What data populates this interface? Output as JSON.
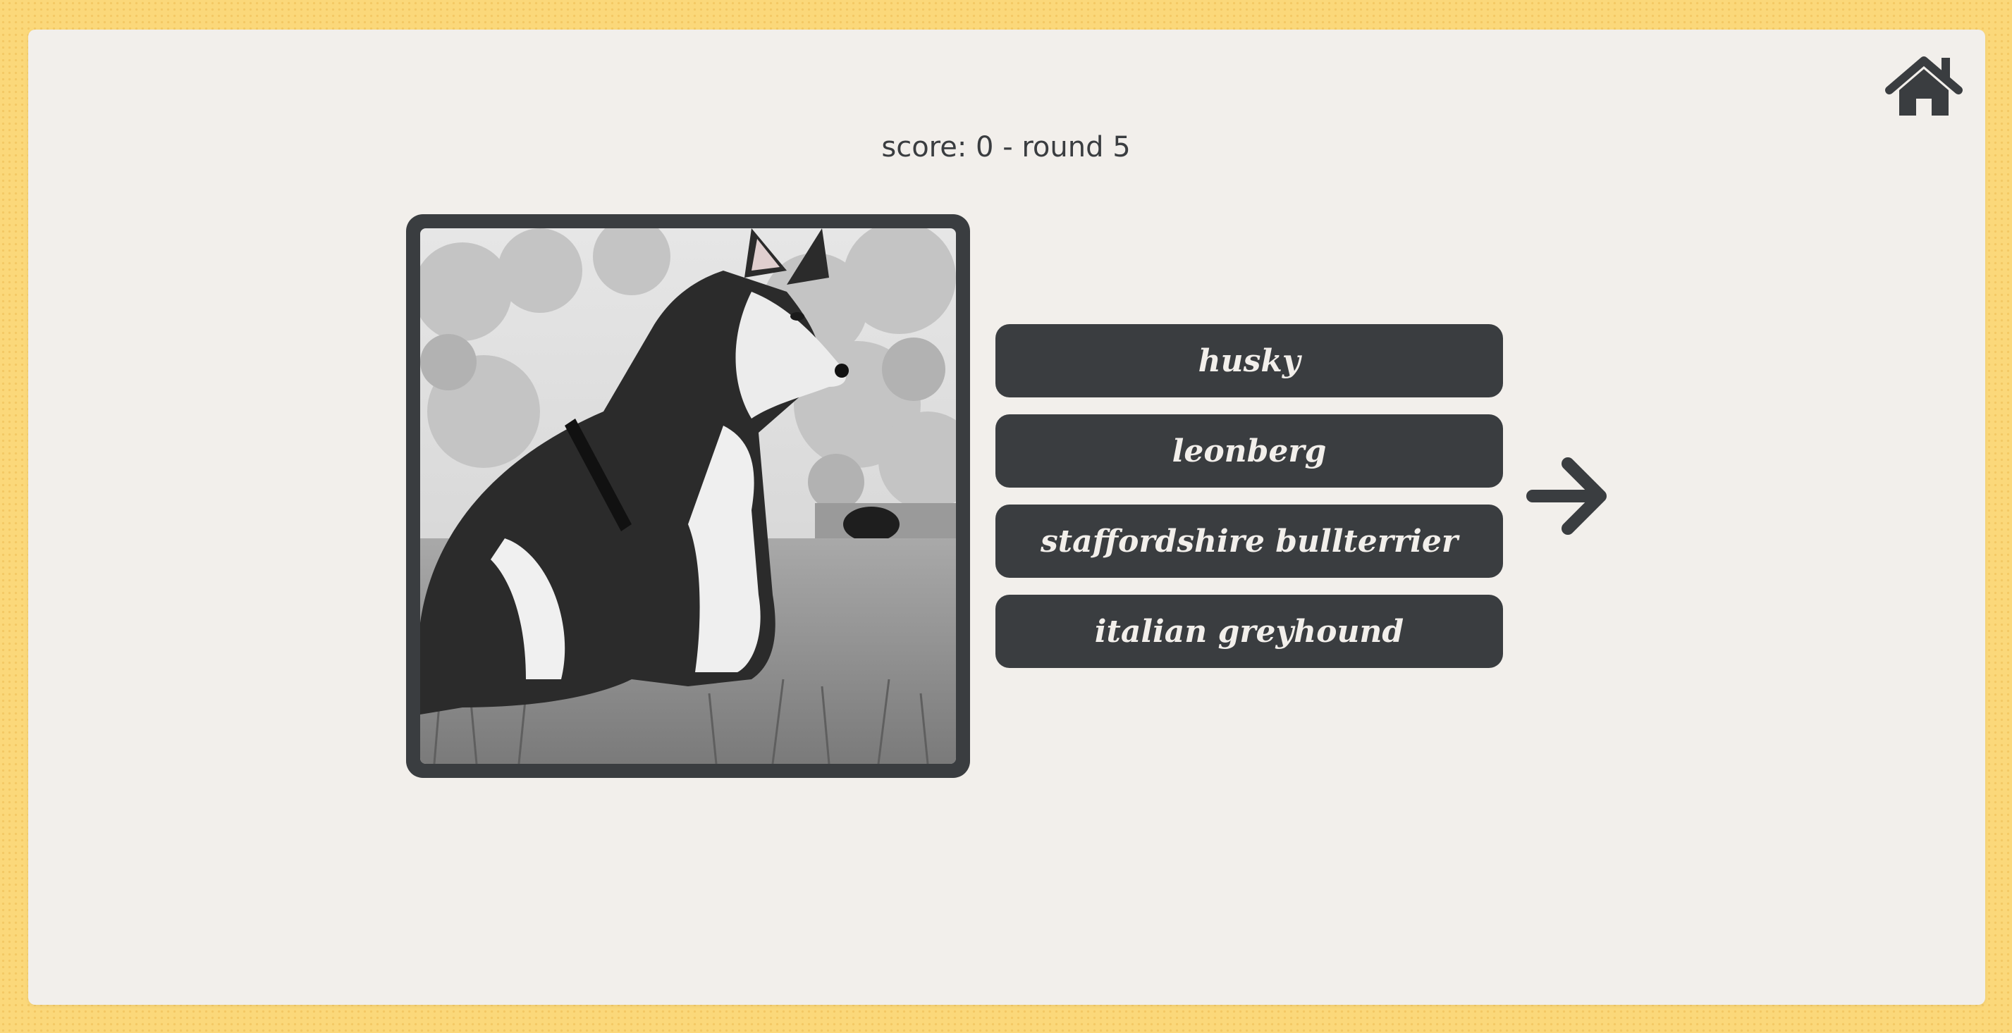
{
  "score_text": "score: 0 - round 5",
  "nav": {
    "home_icon": "home-icon",
    "next_icon": "arrow-right-icon"
  },
  "photo": {
    "subject": "husky puppy sitting on grass (black and white photo)"
  },
  "answers": [
    {
      "label": "husky"
    },
    {
      "label": "leonberg"
    },
    {
      "label": "staffordshire bullterrier"
    },
    {
      "label": "italian greyhound"
    }
  ],
  "colors": {
    "background": "#fbd87a",
    "panel": "#f2efeb",
    "dark": "#3a3d40",
    "button_text": "#f2efeb"
  }
}
